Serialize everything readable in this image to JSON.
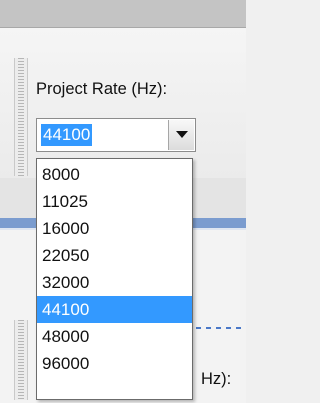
{
  "project_rate": {
    "label": "Project Rate (Hz):",
    "value": "44100",
    "options": [
      "8000",
      "11025",
      "16000",
      "22050",
      "32000",
      "44100",
      "48000",
      "96000"
    ],
    "selected_index": 5,
    "selected_color": "#3399ff"
  },
  "background_label": "Hz):",
  "icons": {
    "combo_toggle": "triangle-down-icon",
    "toolbar_grip": "grip-icon"
  }
}
